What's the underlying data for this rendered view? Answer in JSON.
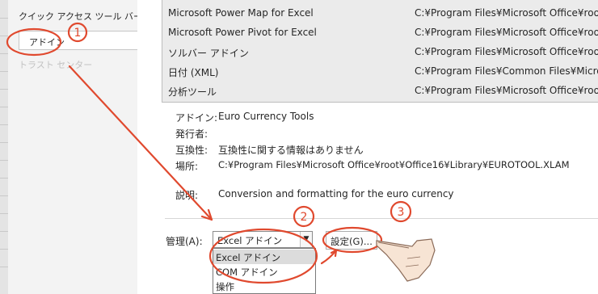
{
  "nav": {
    "quick_access": "クイック アクセス ツール バー",
    "addins": "アドイン",
    "trust_center": "トラスト センター"
  },
  "addin_list": [
    {
      "name": "Microsoft Power Map for Excel",
      "location": "C:¥Program Files¥Microsoft Office¥root¥"
    },
    {
      "name": "Microsoft Power Pivot for Excel",
      "location": "C:¥Program Files¥Microsoft Office¥root¥"
    },
    {
      "name": "ソルバー アドイン",
      "location": "C:¥Program Files¥Microsoft Office¥root¥"
    },
    {
      "name": "日付 (XML)",
      "location": "C:¥Program Files¥Common Files¥Microso"
    },
    {
      "name": "分析ツール",
      "location": "C:¥Program Files¥Microsoft Office¥root¥"
    }
  ],
  "details": {
    "addin_label": "アドイン:",
    "addin_value": "Euro Currency Tools",
    "publisher_label": "発行者:",
    "publisher_value": "",
    "compat_label": "互換性:",
    "compat_value": "互換性に関する情報はありません",
    "location_label": "場所:",
    "location_value": "C:¥Program Files¥Microsoft Office¥root¥Office16¥Library¥EUROTOOL.XLAM",
    "desc_label": "説明:",
    "desc_value": "Conversion and formatting for the euro currency"
  },
  "manage": {
    "label": "管理(A):",
    "selected": "Excel アドイン",
    "options": [
      "Excel アドイン",
      "COM アドイン",
      "操作"
    ],
    "settings_button": "設定(G)..."
  },
  "annotations": {
    "one": "1",
    "two": "2",
    "three": "3",
    "color": "#e0492e"
  }
}
